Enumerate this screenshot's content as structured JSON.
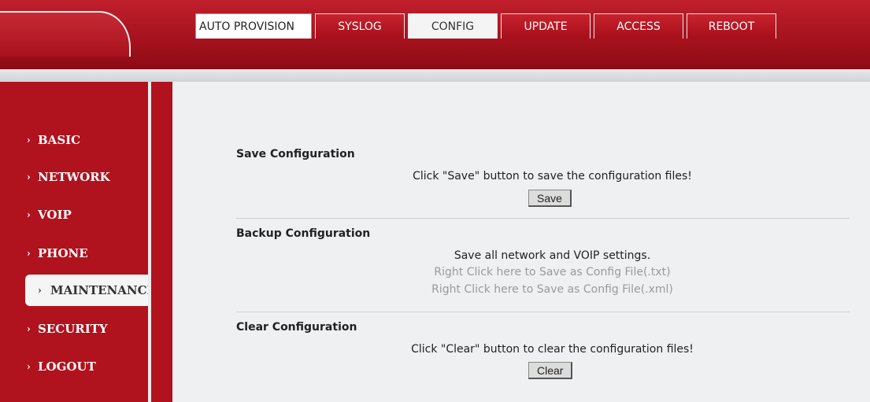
{
  "tabs": [
    {
      "label": "AUTO PROVISION"
    },
    {
      "label": "SYSLOG"
    },
    {
      "label": "CONFIG"
    },
    {
      "label": "UPDATE"
    },
    {
      "label": "ACCESS"
    },
    {
      "label": "REBOOT"
    }
  ],
  "sidebar": {
    "items": [
      {
        "label": "BASIC"
      },
      {
        "label": "NETWORK"
      },
      {
        "label": "VOIP"
      },
      {
        "label": "PHONE"
      },
      {
        "label": "MAINTENANCE"
      },
      {
        "label": "SECURITY"
      },
      {
        "label": "LOGOUT"
      }
    ]
  },
  "save": {
    "title": "Save Configuration",
    "description": "Click \"Save\" button to save the configuration files!",
    "button": "Save"
  },
  "backup": {
    "title": "Backup Configuration",
    "description": "Save all network and VOIP settings.",
    "link_txt": "Right Click here to Save as Config File(.txt)",
    "link_xml": "Right Click here to Save as Config File(.xml)"
  },
  "clear": {
    "title": "Clear Configuration",
    "description": "Click \"Clear\" button to clear the configuration files!",
    "button": "Clear"
  },
  "colors": {
    "brand_red": "#b0121e",
    "background": "#eef0f2"
  }
}
